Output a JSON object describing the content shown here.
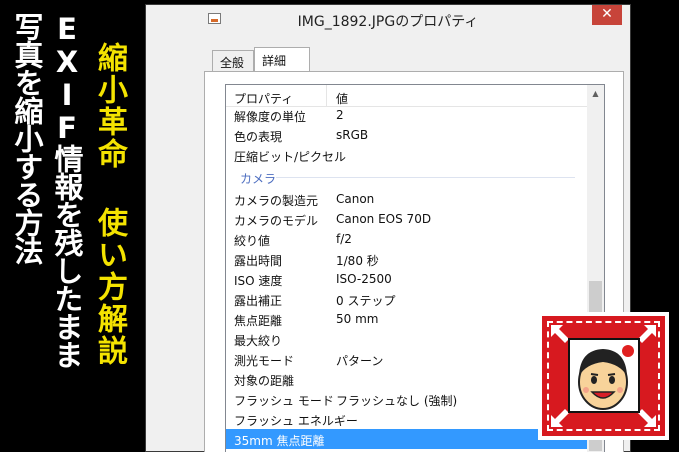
{
  "banner": {
    "headline_line1": "EXIF情報を残したまま",
    "headline_line2": "写真を縮小する方法",
    "subtitle": "縮小革命 使い方解説"
  },
  "window": {
    "title": "IMG_1892.JPGのプロパティ",
    "close_glyph": "✕",
    "tabs": [
      {
        "label": "全般"
      },
      {
        "label": "詳細"
      }
    ],
    "columns": {
      "property": "プロパティ",
      "value": "値"
    },
    "rows_image": [
      {
        "name": "解像度の単位",
        "value": "2"
      },
      {
        "name": "色の表現",
        "value": "sRGB"
      },
      {
        "name": "圧縮ビット/ピクセル",
        "value": ""
      }
    ],
    "group_camera": "カメラ",
    "rows_camera": [
      {
        "name": "カメラの製造元",
        "value": "Canon"
      },
      {
        "name": "カメラのモデル",
        "value": "Canon EOS 70D"
      },
      {
        "name": "絞り値",
        "value": "f/2"
      },
      {
        "name": "露出時間",
        "value": "1/80 秒"
      },
      {
        "name": "ISO 速度",
        "value": "ISO-2500"
      },
      {
        "name": "露出補正",
        "value": "0 ステップ"
      },
      {
        "name": "焦点距離",
        "value": "50 mm"
      },
      {
        "name": "最大絞り",
        "value": ""
      },
      {
        "name": "測光モード",
        "value": "パターン"
      },
      {
        "name": "対象の距離",
        "value": ""
      },
      {
        "name": "フラッシュ モード",
        "value": "フラッシュなし (強制)"
      },
      {
        "name": "フラッシュ エネルギー",
        "value": ""
      },
      {
        "name": "35mm 焦点距離",
        "value": ""
      }
    ],
    "selected_row": "35mm 焦点距離"
  },
  "colors": {
    "subtitle": "#f4e300",
    "badge": "#d7191f",
    "selection": "#3399ff",
    "close_button": "#c7443a"
  },
  "icons": {
    "window_icon": "image-file-icon",
    "scroll_up": "scroll-up-arrow-icon",
    "badge_arrows": "shrink-arrow-icon",
    "avatar": "cartoon-face-icon"
  }
}
